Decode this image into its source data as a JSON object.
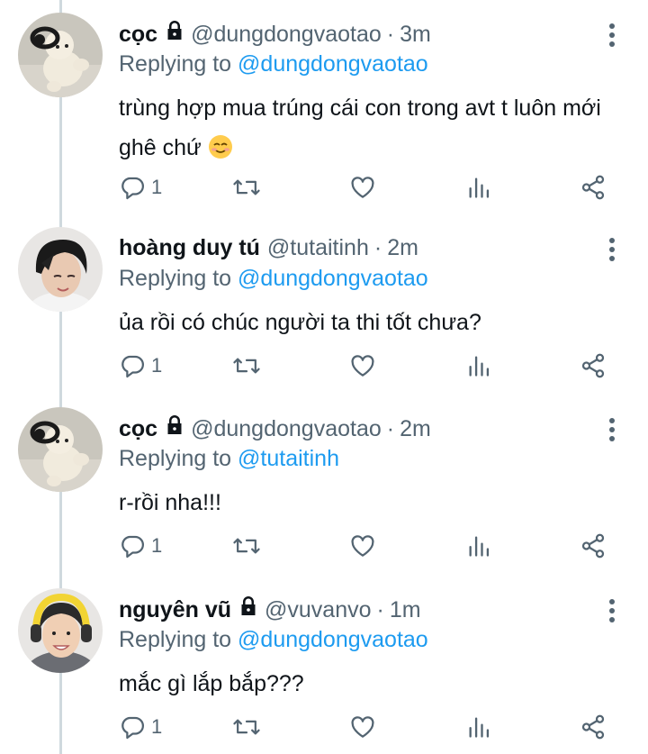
{
  "tweets": [
    {
      "name": "cọc",
      "handle": "@dungdongvaotao",
      "dot": "·",
      "time": "3m",
      "replying_prefix": "Replying to",
      "replying_to": "@dungdongvaotao",
      "text": "trùng hợp mua trúng cái con trong avt t luôn mới ghê chứ",
      "emoji": "smiling-face-emoji",
      "reply_count": "1",
      "locked": true
    },
    {
      "name": "hoàng duy tú",
      "handle": "@tutaitinh",
      "dot": "·",
      "time": "2m",
      "replying_prefix": "Replying to",
      "replying_to": "@dungdongvaotao",
      "text": "ủa rồi có chúc người ta thi tốt chưa?",
      "reply_count": "1",
      "locked": false
    },
    {
      "name": "cọc",
      "handle": "@dungdongvaotao",
      "dot": "·",
      "time": "2m",
      "replying_prefix": "Replying to",
      "replying_to": "@tutaitinh",
      "text": "r-rồi nha!!!",
      "reply_count": "1",
      "locked": true
    },
    {
      "name": "nguyên vũ",
      "handle": "@vuvanvo",
      "dot": "·",
      "time": "1m",
      "replying_prefix": "Replying to",
      "replying_to": "@dungdongvaotao",
      "text": "mắc gì lắp bắp???",
      "reply_count": "1",
      "locked": true
    }
  ],
  "icons": {
    "reply": "reply-icon",
    "retweet": "retweet-icon",
    "like": "heart-icon",
    "views": "analytics-icon",
    "share": "share-icon",
    "more": "more-vertical-icon",
    "lock": "lock-icon"
  },
  "colors": {
    "text": "#0f1419",
    "secondary": "#536471",
    "link": "#1d9bf0",
    "thread_line": "#cfd9de"
  }
}
